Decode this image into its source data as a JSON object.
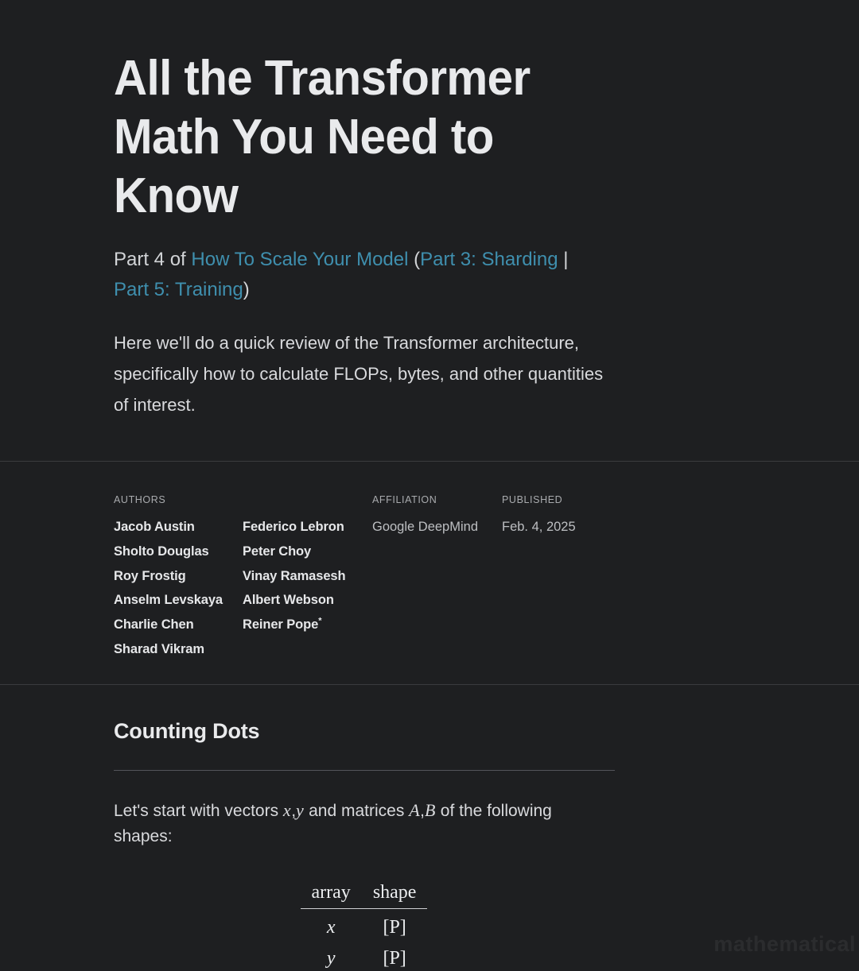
{
  "page": {
    "background_color": "#1e1f21",
    "text_color": "#d9dadd",
    "heading_color": "#e9eaec",
    "link_color": "#3f8fae",
    "rule_color": "#3a3b3e"
  },
  "hero": {
    "title": "All the Transformer Math You Need to Know",
    "subtitle": {
      "prefix": "Part 4 of ",
      "series_link": "How To Scale Your Model",
      "open_paren": " (",
      "prev_link": "Part 3: Sharding",
      "separator": " | ",
      "next_link": "Part 5: Training",
      "close_paren": ")"
    },
    "lede": "Here we'll do a quick review of the Transformer architecture, specifically how to calculate FLOPs, bytes, and other quantities of interest."
  },
  "meta": {
    "authors_label": "AUTHORS",
    "affiliation_label": "AFFILIATION",
    "published_label": "PUBLISHED",
    "authors_col1": [
      "Jacob Austin",
      "Sholto Douglas",
      "Roy Frostig",
      "Anselm Levskaya",
      "Charlie Chen",
      "Sharad Vikram"
    ],
    "authors_col2": [
      "Federico Lebron",
      "Peter Choy",
      "Vinay Ramasesh",
      "Albert Webson",
      "Reiner Pope"
    ],
    "author_footnote_marker": "*",
    "footnote_author": "Reiner Pope",
    "affiliation": "Google DeepMind",
    "published": "Feb. 4, 2025"
  },
  "section": {
    "heading": "Counting Dots",
    "paragraph": {
      "part1": "Let's start with vectors ",
      "var_x": "x",
      "comma1": ",",
      "var_y": "y",
      "part2": " and matrices ",
      "var_A": "A",
      "comma2": ",",
      "var_B": "B",
      "part3": " of the following shapes:"
    }
  },
  "math_table": {
    "headers": [
      "array",
      "shape"
    ],
    "rows": [
      {
        "array": "x",
        "shape": "[P]"
      },
      {
        "array": "y",
        "shape": "[P]"
      }
    ]
  },
  "overlay": {
    "faint_text": "mathematical"
  }
}
